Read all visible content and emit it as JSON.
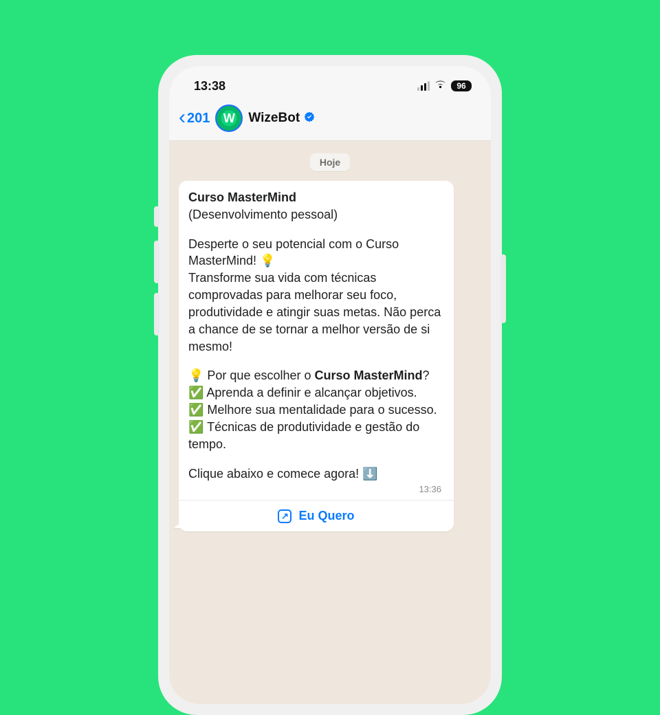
{
  "statusbar": {
    "time": "13:38",
    "battery": "96"
  },
  "header": {
    "back_count": "201",
    "contact_name": "WizeBot",
    "avatar_letter": "W"
  },
  "chat": {
    "date_label": "Hoje",
    "message": {
      "title": "Curso MasterMind",
      "subtitle": "(Desenvolvimento pessoal)",
      "intro_line1": "Desperte o seu potencial com o Curso MasterMind! 💡",
      "intro_line2": "Transforme sua vida com técnicas comprovadas para melhorar seu foco, produtividade e atingir suas metas. Não perca a chance de se tornar a melhor versão de si mesmo!",
      "why_prefix": "💡 Por que escolher o ",
      "why_bold": "Curso MasterMind",
      "why_suffix": "?",
      "bullet1": "✅ Aprenda a definir e alcançar objetivos.",
      "bullet2": "✅ Melhore sua mentalidade para o sucesso.",
      "bullet3": "✅ Técnicas de produtividade e gestão do tempo.",
      "cta_line": "Clique abaixo e comece agora! ⬇️",
      "time": "13:36",
      "action_label": "Eu Quero"
    }
  }
}
